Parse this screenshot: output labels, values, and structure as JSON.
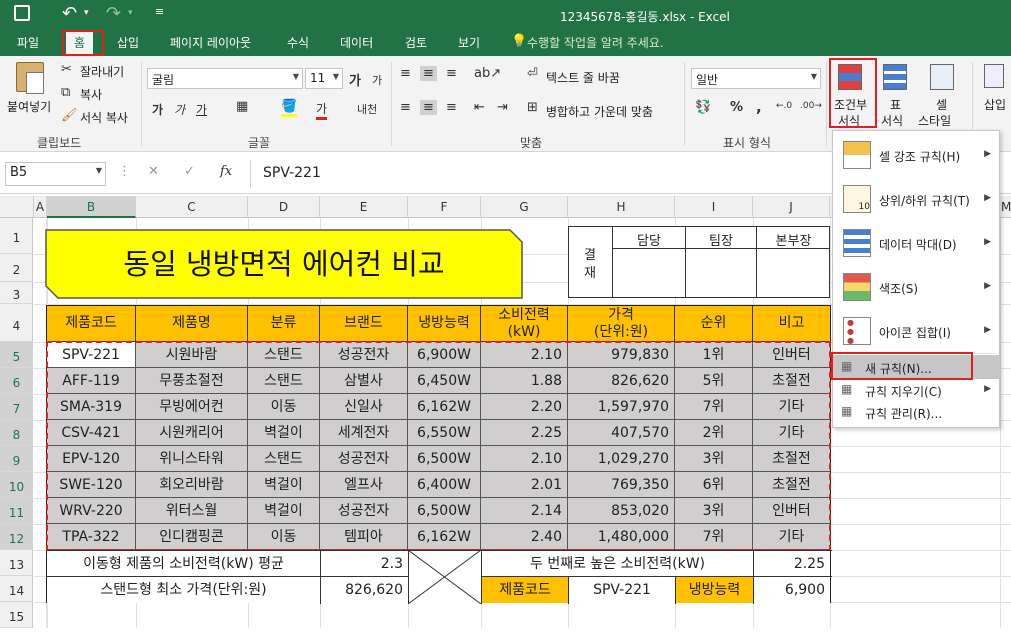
{
  "titlebar": {
    "title": "12345678-홍길동.xlsx  -  Excel"
  },
  "tabs": [
    "파일",
    "홈",
    "삽입",
    "페이지 레이아웃",
    "수식",
    "데이터",
    "검토",
    "보기"
  ],
  "tell_me": "수행할 작업을 알려 주세요.",
  "clipboard": {
    "paste": "붙여넣기",
    "cut": "잘라내기",
    "copy": "복사",
    "format_painter": "서식 복사",
    "group": "클립보드"
  },
  "font": {
    "name": "굴림",
    "size": "11",
    "grow": "가",
    "shrink": "가",
    "bold": "가",
    "italic": "가",
    "underline": "가",
    "color_letter": "가",
    "phonetic": "내천",
    "group": "글꼴"
  },
  "alignment": {
    "wrap": "텍스트 줄 바꿈",
    "merge": "병합하고 가운데 맞춤",
    "group": "맞춤"
  },
  "number": {
    "format": "일반",
    "percent": "%",
    "comma": ",",
    "group": "표시 형식"
  },
  "styles": {
    "conditional": "조건부",
    "conditional2": "서식",
    "table": "표",
    "table2": "서식",
    "cell": "셀",
    "cell2": "스타일"
  },
  "cells": {
    "insert": "삽입"
  },
  "formula_bar": {
    "name_box": "B5",
    "fx": "fx",
    "value": "SPV-221"
  },
  "columns": [
    "A",
    "B",
    "C",
    "D",
    "E",
    "F",
    "G",
    "H",
    "I",
    "J",
    "M"
  ],
  "rows": [
    "1",
    "2",
    "3",
    "4",
    "5",
    "6",
    "7",
    "8",
    "9",
    "10",
    "11",
    "12",
    "13",
    "14",
    "15"
  ],
  "sheet": {
    "title": "동일 냉방면적 에어컨 비교",
    "approval": {
      "label1": "결",
      "label2": "재",
      "cols": [
        "담당",
        "팀장",
        "본부장"
      ]
    },
    "headers": [
      "제품코드",
      "제품명",
      "분류",
      "브랜드",
      "냉방능력",
      "소비전력",
      "(kW)",
      "가격",
      "(단위:원)",
      "순위",
      "비고"
    ],
    "data": [
      [
        "SPV-221",
        "시원바람",
        "스탠드",
        "성공전자",
        "6,900W",
        "2.10",
        "979,830",
        "1위",
        "인버터"
      ],
      [
        "AFF-119",
        "무풍초절전",
        "스탠드",
        "삼별사",
        "6,450W",
        "1.88",
        "826,620",
        "5위",
        "초절전"
      ],
      [
        "SMA-319",
        "무빙에어컨",
        "이동",
        "신일사",
        "6,162W",
        "2.20",
        "1,597,970",
        "7위",
        "기타"
      ],
      [
        "CSV-421",
        "시원캐리어",
        "벽걸이",
        "세계전자",
        "6,550W",
        "2.25",
        "407,570",
        "2위",
        "기타"
      ],
      [
        "EPV-120",
        "위니스타워",
        "스탠드",
        "성공전자",
        "6,500W",
        "2.10",
        "1,029,270",
        "3위",
        "초절전"
      ],
      [
        "SWE-120",
        "회오리바람",
        "벽걸이",
        "엘프사",
        "6,400W",
        "2.01",
        "769,350",
        "6위",
        "초절전"
      ],
      [
        "WRV-220",
        "위터스월",
        "벽걸이",
        "성공전자",
        "6,500W",
        "2.14",
        "853,020",
        "3위",
        "인버터"
      ],
      [
        "TPA-322",
        "인디캠핑콘",
        "이동",
        "템피아",
        "6,162W",
        "2.40",
        "1,480,000",
        "7위",
        "기타"
      ]
    ],
    "summary": {
      "r13_label": "이동형 제품의 소비전력(kW) 평균",
      "r13_value": "2.3",
      "r13_label2": "두 번째로 높은 소비전력(kW)",
      "r13_value2": "2.25",
      "r14_label": "스탠드형 최소 가격(단위:원)",
      "r14_value": "826,620",
      "r14_code_label": "제품코드",
      "r14_code": "SPV-221",
      "r14_cap_label": "냉방능력",
      "r14_cap": "6,900"
    }
  },
  "cf_menu": {
    "items": [
      {
        "label": "셀 강조 규칙(H)",
        "submenu": true
      },
      {
        "label": "상위/하위 규칙(T)",
        "submenu": true
      },
      {
        "label": "데이터 막대(D)",
        "submenu": true
      },
      {
        "label": "색조(S)",
        "submenu": true
      },
      {
        "label": "아이콘 집합(I)",
        "submenu": true
      }
    ],
    "new_rule": "새 규칙(N)...",
    "clear_rules": "규칙 지우기(C)",
    "manage_rules": "규칙 관리(R)..."
  },
  "colors": {
    "excel_green": "#217346",
    "header_orange": "#ffc000",
    "title_yellow": "#ffff00",
    "highlight_red": "#e02020"
  }
}
